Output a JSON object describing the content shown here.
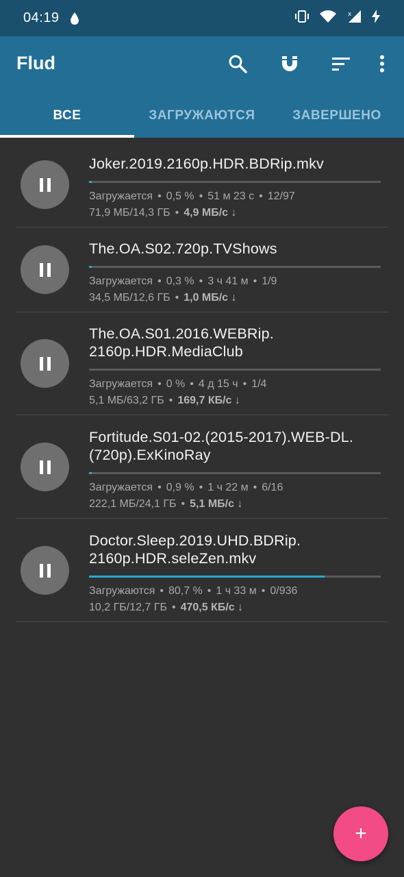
{
  "status_bar": {
    "time": "04:19",
    "icons": [
      "water-drop-icon",
      "vibrate-icon",
      "wifi-icon",
      "signal-icon",
      "charging-icon"
    ]
  },
  "app_bar": {
    "title": "Flud",
    "actions": [
      "search-icon",
      "magnet-icon",
      "sort-icon",
      "more-vert-icon"
    ],
    "tabs": [
      {
        "label": "ВСЕ",
        "active": true
      },
      {
        "label": "ЗАГРУЖАЮТСЯ",
        "active": false
      },
      {
        "label": "ЗАВЕРШЕНО",
        "active": false
      }
    ]
  },
  "torrents": [
    {
      "name": "Joker.2019.2160p.HDR.BDRip.mkv",
      "status": "Загружается",
      "percent_text": "0,5 %",
      "eta": "51 м 23 с",
      "files": "12/97",
      "size": "71,9 МБ/14,3 ГБ",
      "speed": "4,9 МБ/с ↓",
      "progress": 0.005
    },
    {
      "name": "The.OA.S02.720p.TVShows",
      "status": "Загружается",
      "percent_text": "0,3 %",
      "eta": "3 ч 41 м",
      "files": "1/9",
      "size": "34,5 МБ/12,6 ГБ",
      "speed": "1,0 МБ/с ↓",
      "progress": 0.003
    },
    {
      "name": "The.OA.S01.2016.WEBRip.\n2160p.HDR.MediaClub",
      "status": "Загружается",
      "percent_text": "0 %",
      "eta": "4 д 15 ч",
      "files": "1/4",
      "size": "5,1 МБ/63,2 ГБ",
      "speed": "169,7 КБ/с ↓",
      "progress": 0
    },
    {
      "name": "Fortitude.S01-02.(2015-2017).WEB-DL.\n(720p).ExKinoRay",
      "status": "Загружается",
      "percent_text": "0,9 %",
      "eta": "1 ч 22 м",
      "files": "6/16",
      "size": "222,1 МБ/24,1 ГБ",
      "speed": "5,1 МБ/с ↓",
      "progress": 0.009
    },
    {
      "name": "Doctor.Sleep.2019.UHD.BDRip.\n2160p.HDR.seleZen.mkv",
      "status": "Загружаются",
      "percent_text": "80,7 %",
      "eta": "1 ч 33 м",
      "files": "0/936",
      "size": "10,2 ГБ/12,7 ГБ",
      "speed": "470,5 КБ/с ↓",
      "progress": 0.807
    }
  ],
  "fab": {
    "label": "+"
  },
  "colors": {
    "status_bar_bg": "#1a4f6e",
    "app_bar_bg": "#236e95",
    "list_bg": "#303030",
    "progress": "#29a8d4",
    "fab": "#f24b85"
  }
}
